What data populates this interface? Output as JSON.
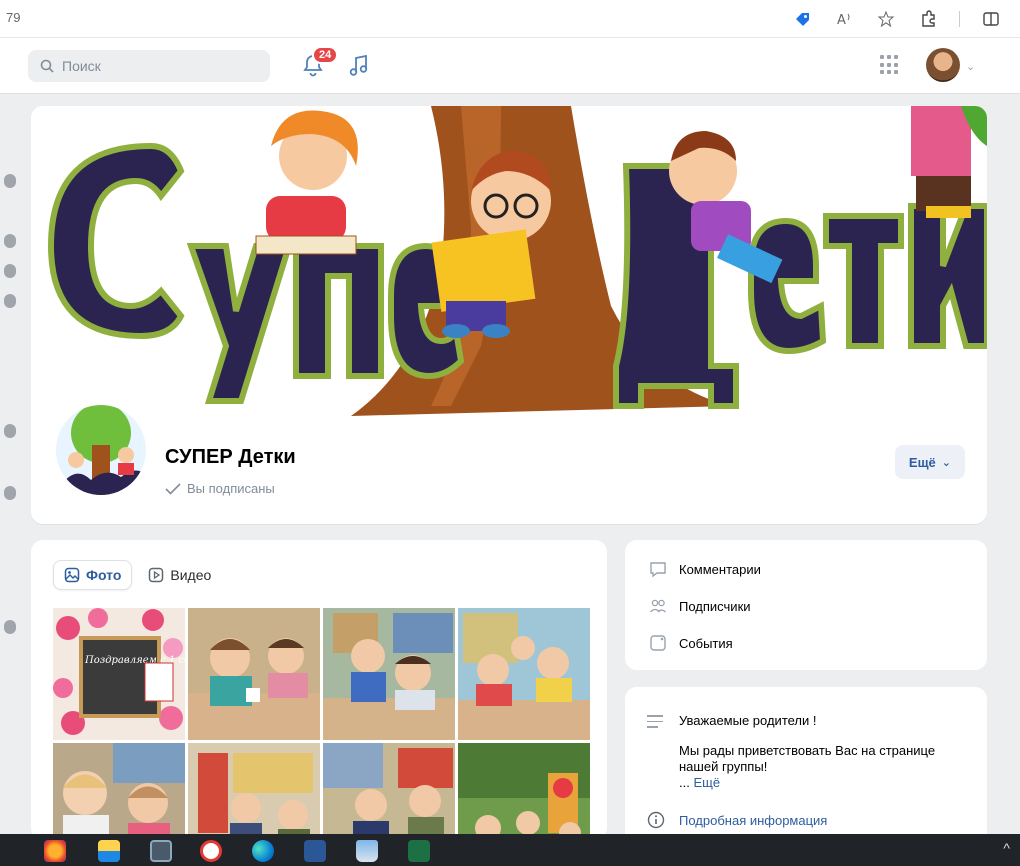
{
  "browser": {
    "left_text": "79",
    "icons": [
      "tag-icon",
      "read-aloud-icon",
      "favorite-star-icon",
      "extensions-icon",
      "split-screen-icon"
    ]
  },
  "header": {
    "search_placeholder": "Поиск",
    "notifications_count": "24"
  },
  "group": {
    "name": "СУПЕР Детки",
    "subscribed_label": "Вы подписаны",
    "more_label": "Ещё"
  },
  "media": {
    "tabs": [
      {
        "label": "Фото",
        "active": true
      },
      {
        "label": "Видео",
        "active": false
      }
    ],
    "first_photo_text": "Поздравляем с 1 сентября"
  },
  "links": {
    "items": [
      {
        "label": "Комментарии",
        "icon": "comment-icon"
      },
      {
        "label": "Подписчики",
        "icon": "users-icon"
      },
      {
        "label": "События",
        "icon": "calendar-icon"
      }
    ]
  },
  "info": {
    "title": "Уважаемые родители !",
    "body": "Мы рады приветствовать Вас на странице нашей группы!",
    "more_prefix": "...",
    "more_link": "Ещё",
    "details_link": "Подробная информация"
  },
  "colors": {
    "accent": "#2d5d9f",
    "badge": "#e64646",
    "page_bg": "#edeef0"
  }
}
